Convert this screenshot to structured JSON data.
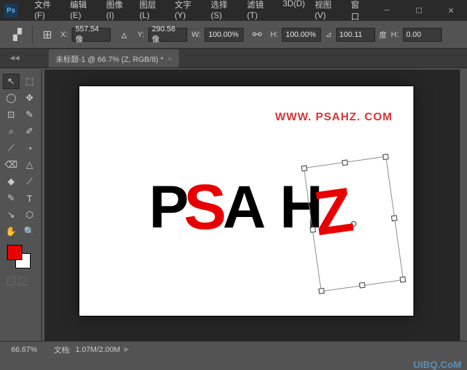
{
  "app": {
    "logo": "Ps"
  },
  "menu": [
    "文件(F)",
    "编辑(E)",
    "图像(I)",
    "图层(L)",
    "文字(Y)",
    "选择(S)",
    "滤镜(T)",
    "3D(D)",
    "视图(V)",
    "窗口"
  ],
  "options": {
    "x_label": "X:",
    "x_value": "557.54 像",
    "y_label": "Y:",
    "y_value": "290.58 像",
    "w_label": "W:",
    "w_value": "100.00%",
    "h_label": "H:",
    "h_value": "100.00%",
    "a_label": "⊿",
    "a_value": "100.11",
    "a_unit": "度",
    "h2_label": "H:",
    "h2_value": "0.00"
  },
  "tab": {
    "title": "未标题-1 @ 66.7% (Z, RGB/8) *",
    "close": "×"
  },
  "tools": [
    "↖",
    "⬚",
    "◯",
    "✥",
    "⊡",
    "✎",
    "⌕",
    "✐",
    "⟋",
    "◔",
    "⌫",
    "△",
    "◆",
    "⟋",
    "✎",
    "T",
    "↘",
    "⬡",
    "✋",
    "🔍"
  ],
  "swatch": {
    "fg": "#e80000",
    "bg": "#ffffff"
  },
  "canvas": {
    "url": "WWW. PSAHZ. COM",
    "letters": {
      "p": "P",
      "s": "S",
      "a": "A",
      "h": "H",
      "z": "Z"
    }
  },
  "status": {
    "zoom": "66.67%",
    "doc_label": "文档:",
    "doc_value": "1.07M/2.00M"
  },
  "watermark": "UiBQ.CoM"
}
